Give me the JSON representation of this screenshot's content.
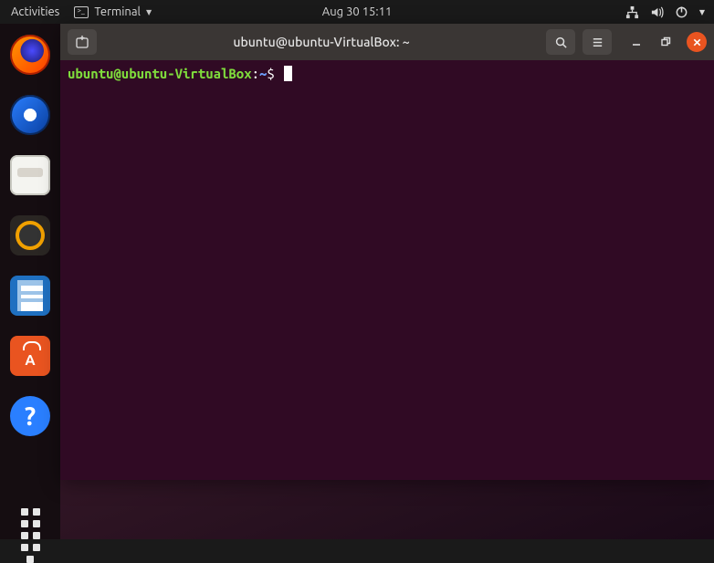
{
  "top_panel": {
    "activities": "Activities",
    "app_menu": {
      "label": "Terminal"
    },
    "clock": "Aug 30  15:11",
    "status_icons": {
      "network": "network-wired-icon",
      "volume": "volume-high-icon",
      "power": "power-icon",
      "chevron": "chevron-down-icon"
    }
  },
  "dock": {
    "items": [
      {
        "name": "firefox",
        "label": "Firefox"
      },
      {
        "name": "thunderbird",
        "label": "Thunderbird"
      },
      {
        "name": "files",
        "label": "Files"
      },
      {
        "name": "rhythmbox",
        "label": "Rhythmbox"
      },
      {
        "name": "writer",
        "label": "LibreOffice Writer"
      },
      {
        "name": "software",
        "label": "Ubuntu Software"
      },
      {
        "name": "help",
        "label": "Help",
        "glyph": "?"
      }
    ],
    "show_apps_label": "Show Applications"
  },
  "terminal": {
    "title": "ubuntu@ubuntu-VirtualBox: ~",
    "prompt": {
      "user_host": "ubuntu@ubuntu-VirtualBox",
      "separator": ":",
      "path": "~",
      "symbol": "$"
    },
    "input": "",
    "toolbar": {
      "new_tab": "New Tab",
      "search": "Search",
      "menu": "Menu",
      "minimize": "Minimize",
      "maximize": "Restore",
      "close": "Close"
    }
  }
}
